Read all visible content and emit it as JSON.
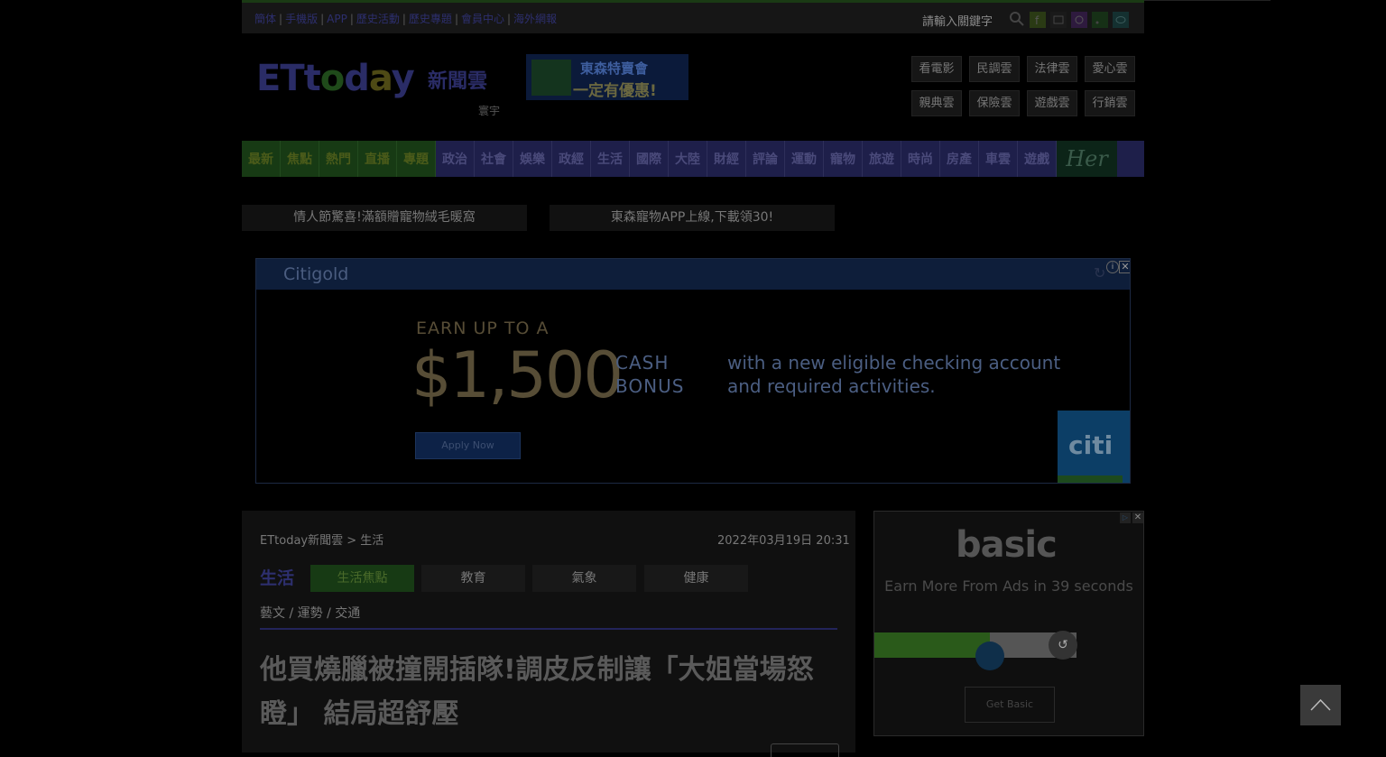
{
  "top_links": [
    "簡体",
    "手機版",
    "APP",
    "歷史活動",
    "歷史專題",
    "會員中心",
    "海外網報"
  ],
  "search_label": "請輸入關鍵字",
  "social": [
    {
      "icon": "facebook-icon",
      "color": "#2a3a14"
    },
    {
      "icon": "youtube-icon",
      "color": "#222"
    },
    {
      "icon": "instagram-icon",
      "color": "#3a1a4a"
    },
    {
      "icon": "rss-icon",
      "color": "#1a3a1a"
    },
    {
      "icon": "line-icon",
      "color": "#1a3a3a"
    }
  ],
  "logo": {
    "prefix": "ETt",
    "o1": "o",
    "mid": "d",
    "o2": "a",
    "suffix": "y",
    "cn": "新聞雲",
    "sub": "寰宇"
  },
  "banner": {
    "line1": "東森特賣會",
    "line2": "一定有優惠!"
  },
  "header_buttons": [
    "看電影",
    "民調雲",
    "法律雲",
    "愛心雲",
    "親典雲",
    "保險雲",
    "遊戲雲",
    "行銷雲"
  ],
  "nav": {
    "green": [
      "最新",
      "焦點",
      "熱門",
      "直播",
      "專題"
    ],
    "items": [
      "政治",
      "社會",
      "娛樂",
      "政經",
      "生活",
      "國際",
      "大陸",
      "財經",
      "評論",
      "運動",
      "寵物",
      "旅遊",
      "時尚",
      "房產",
      "車雲",
      "遊戲"
    ],
    "her": "Her"
  },
  "promos": [
    "情人節驚喜!滿額贈寵物絨毛暖窩",
    "東森寵物APP上線,下載領30!"
  ],
  "ad": {
    "brand": "Citigold",
    "earn": "EARN UP TO A",
    "amount": "$1,500",
    "cash": "CASH BONUS",
    "desc": "with a new eligible checking account and required activities.",
    "apply": "Apply Now",
    "citi": "citi"
  },
  "article": {
    "breadcrumb": "ETtoday新聞雲 > 生活",
    "date": "2022年03月19日 20:31",
    "category": "生活",
    "tabs": [
      "生活焦點",
      "教育",
      "氣象",
      "健康"
    ],
    "subcats": "藝文 / 運勢 / 交通",
    "headline": "他買燒臘被撞開插隊!調皮反制讓「大姐當場怒瞪」 結局超舒壓"
  },
  "side_ad": {
    "logo": "basic",
    "text": "Earn More From Ads in 39 seconds",
    "progress": 0.57,
    "button": "Get Basic"
  },
  "colors": {
    "accent": "#1e1f4a",
    "green": "#173a14"
  }
}
